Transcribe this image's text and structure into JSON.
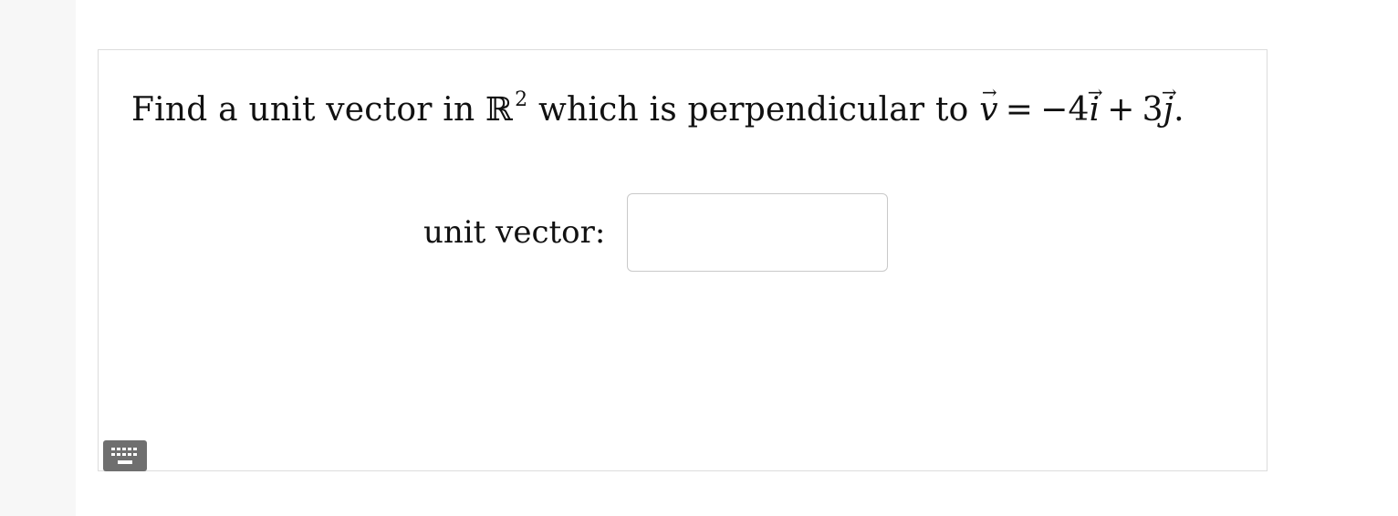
{
  "question": {
    "text_before_math": "Find a unit vector in",
    "space_symbol": "ℝ",
    "space_exponent": "2",
    "text_middle": "which is perpendicular to",
    "vector_v": "v",
    "equals": "=",
    "coef_i": "−4",
    "unit_i": "i",
    "plus": "+",
    "coef_j": "3",
    "unit_j": "j",
    "end_period": "."
  },
  "answer": {
    "label": "unit vector:",
    "value": "",
    "placeholder": ""
  },
  "icons": {
    "keyboard": "keyboard-icon"
  }
}
